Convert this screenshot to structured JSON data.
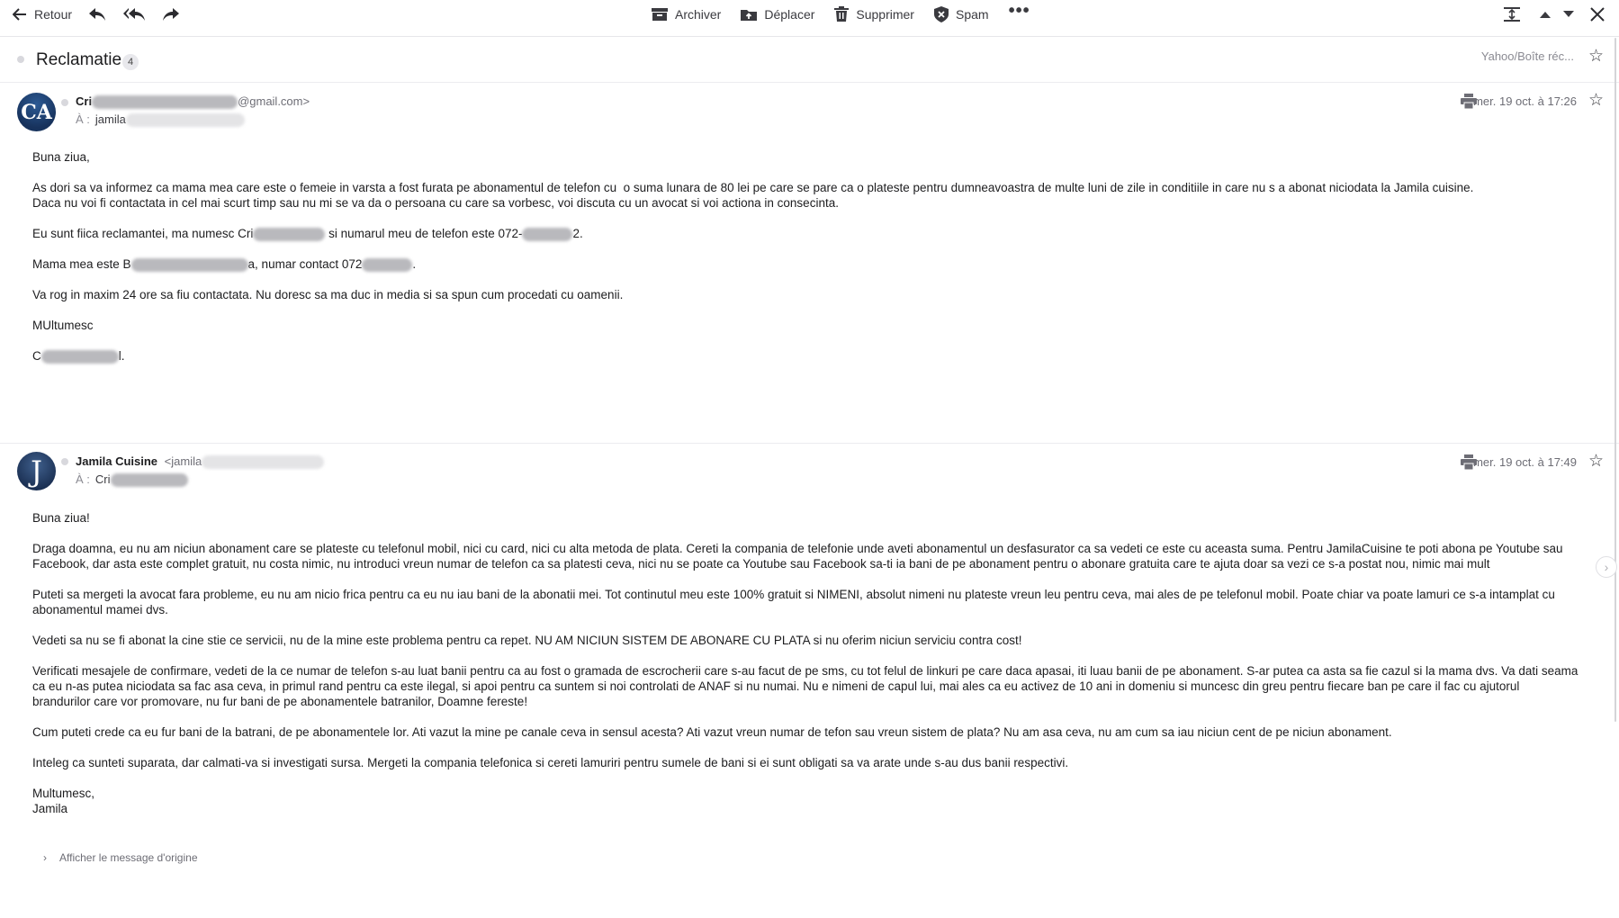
{
  "toolbar": {
    "back_label": "Retour",
    "archive_label": "Archiver",
    "move_label": "Déplacer",
    "delete_label": "Supprimer",
    "spam_label": "Spam",
    "more_label": "•••"
  },
  "thread": {
    "subject": "Reclamatie",
    "count": "4",
    "folder": "Yahoo/Boîte réc..."
  },
  "messages": [
    {
      "avatar_text": "CA",
      "sender_name_visible": "Cri",
      "sender_email_suffix": "@gmail.com>",
      "to_label": "À :",
      "to_value": "jamila",
      "date": "mer. 19 oct. à 17:26",
      "body": {
        "greeting": "Buna ziua,",
        "p1": "As dori sa va informez ca mama mea care este o femeie in varsta a fost furata pe abonamentul de telefon cu  o suma lunara de 80 lei pe care se pare ca o plateste pentru dumneavoastra de multe luni de zile in conditiile in care nu s a abonat niciodata la Jamila cuisine.\nDaca nu voi fi contactata in cel mai scurt timp sau nu mi se va da o persoana cu care sa vorbesc, voi discuta cu un avocat si voi actiona in consecinta.",
        "p2_a": "Eu sunt fiica reclamantei, ma numesc Cri",
        "p2_b": " si numarul meu de telefon este 072-",
        "p2_c": "2.",
        "p3_a": "Mama mea este B",
        "p3_b": "a, numar contact 072",
        "p3_c": ".",
        "p4": "Va rog in maxim 24 ore sa fiu contactata. Nu doresc sa ma duc in media si sa spun cum procedati cu oamenii.",
        "p5": "MUltumesc",
        "sign_a": "C",
        "sign_b": "l."
      }
    },
    {
      "avatar_text": "J",
      "sender_name": "Jamila Cuisine",
      "sender_email_prefix": "<jamila",
      "to_label": "À :",
      "to_value": "Cri",
      "date": "mer. 19 oct. à 17:49",
      "body": {
        "greeting": "Buna ziua!",
        "p1": "Draga doamna, eu nu am niciun abonament care se plateste cu telefonul mobil, nici cu card, nici cu alta metoda de plata. Cereti la compania de telefonie unde aveti abonamentul un desfasurator ca sa vedeti ce este cu aceasta suma. Pentru JamilaCuisine te poti abona pe Youtube sau Facebook, dar asta este complet gratuit, nu costa nimic, nu introduci vreun numar de telefon ca sa platesti ceva, nici nu se poate ca Youtube sau Facebook sa-ti ia bani de pe abonament pentru o abonare gratuita care te ajuta doar sa vezi ce s-a postat nou, nimic mai mult",
        "p2": "Puteti sa mergeti la avocat fara probleme, eu nu am nicio frica pentru ca eu nu iau bani de la abonatii mei. Tot continutul meu este 100% gratuit si NIMENI, absolut nimeni nu plateste vreun leu pentru ceva, mai ales de pe telefonul mobil. Poate chiar va poate lamuri ce s-a intamplat cu abonamentul mamei dvs.",
        "p3": "Vedeti sa nu se fi abonat la cine stie ce servicii, nu de la mine este problema pentru ca repet. NU AM NICIUN SISTEM DE ABONARE CU PLATA si nu oferim niciun serviciu contra cost!",
        "p4": "Verificati mesajele de confirmare, vedeti de la ce numar de telefon s-au luat banii pentru ca au fost o gramada de escrocherii care s-au facut de pe sms, cu tot felul de linkuri pe care daca apasai, iti luau banii de pe abonament. S-ar putea ca asta sa fie cazul si la mama dvs. Va dati seama ca eu n-as putea niciodata sa fac asa ceva, in primul rand pentru ca este ilegal, si apoi pentru ca suntem si noi controlati de ANAF si nu numai. Nu e nimeni de capul lui, mai ales ca eu activez de 10 ani in domeniu si muncesc din greu pentru fiecare ban pe care il fac cu ajutorul brandurilor care vor promovare, nu fur bani de pe abonamentele batranilor, Doamne fereste!",
        "p5": "Cum puteti crede ca eu fur bani de la batrani, de pe abonamentele lor. Ati vazut la mine pe canale ceva in sensul acesta? Ati vazut vreun numar de tefon sau vreun sistem de plata? Nu am asa ceva, nu am cum sa iau niciun cent de pe niciun abonament.",
        "p6": "Inteleg ca sunteti suparata, dar calmati-va si investigati sursa. Mergeti la compania telefonica si cereti lamuriri pentru sumele de bani si ei sunt obligati sa va arate unde s-au dus banii respectivi.",
        "closing": "Multumesc,\nJamila"
      }
    }
  ],
  "show_original_label": "Afficher le message d'origine",
  "colors": {
    "avatar_bg": "#1f3a66",
    "accent": "#3a3a3f"
  }
}
